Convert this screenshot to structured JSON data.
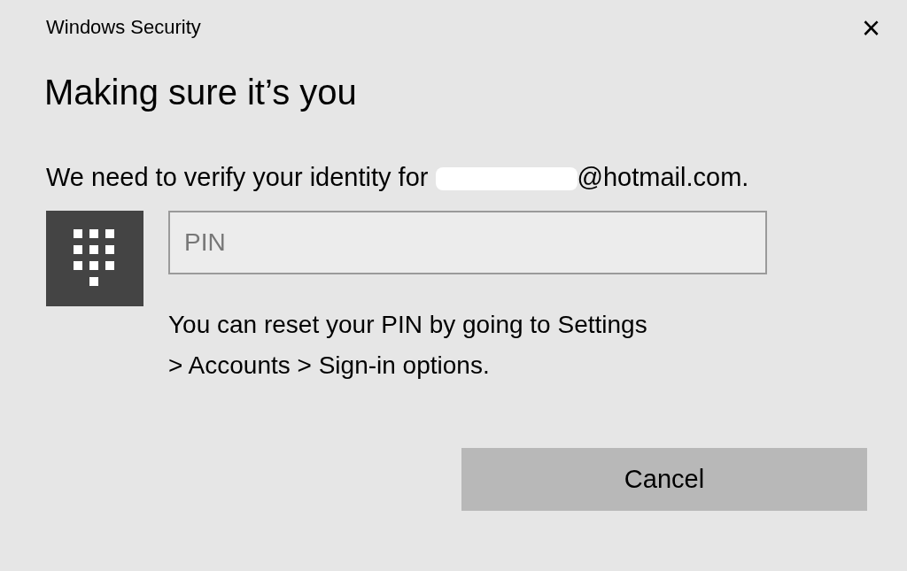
{
  "window": {
    "title": "Windows Security",
    "close": "×"
  },
  "heading": "Making sure it’s you",
  "message": {
    "prefix": "We need to verify your identity for",
    "suffix": "@hotmail.com."
  },
  "pin_field": {
    "placeholder": "PIN"
  },
  "hint_lines": [
    "You can reset your PIN by going to Settings",
    "> Accounts > Sign-in options."
  ],
  "buttons": [
    "Cancel"
  ]
}
